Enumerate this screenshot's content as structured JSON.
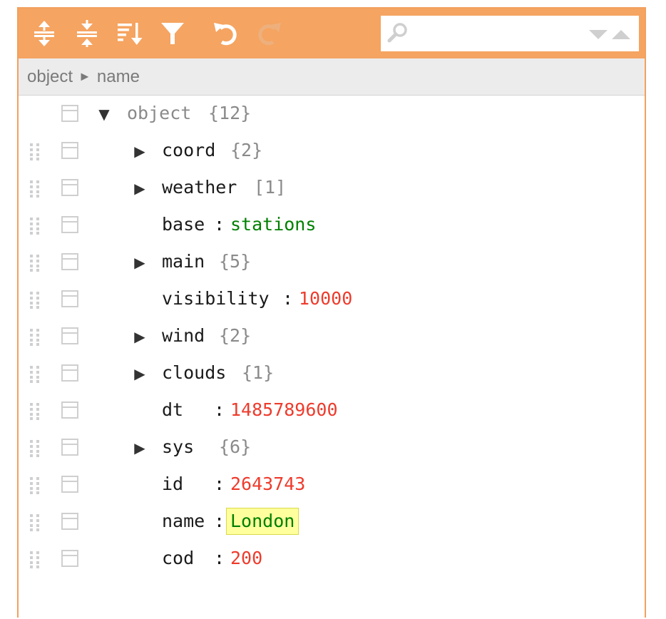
{
  "toolbar": {
    "buttons": [
      {
        "name": "expand-all-button",
        "icon": "expand-all-icon",
        "enabled": true
      },
      {
        "name": "collapse-all-button",
        "icon": "collapse-all-icon",
        "enabled": true
      },
      {
        "name": "sort-button",
        "icon": "sort-icon",
        "enabled": true
      },
      {
        "name": "filter-button",
        "icon": "filter-icon",
        "enabled": true
      },
      {
        "name": "undo-button",
        "icon": "undo-icon",
        "enabled": true
      },
      {
        "name": "redo-button",
        "icon": "redo-icon",
        "enabled": false
      }
    ],
    "search": {
      "value": "",
      "placeholder": ""
    }
  },
  "breadcrumb": {
    "items": [
      "object",
      "name"
    ],
    "separator": "►"
  },
  "tree": {
    "root": {
      "field": "object",
      "count": "{12}",
      "expanded": true
    },
    "nodes": [
      {
        "field": "coord",
        "type": "object",
        "count": "{2}"
      },
      {
        "field": "weather",
        "type": "array",
        "count": "[1]"
      },
      {
        "field": "base",
        "type": "string",
        "value": "stations"
      },
      {
        "field": "main",
        "type": "object",
        "count": "{5}"
      },
      {
        "field": "visibility",
        "type": "number",
        "value": "10000"
      },
      {
        "field": "wind",
        "type": "object",
        "count": "{2}"
      },
      {
        "field": "clouds",
        "type": "object",
        "count": "{1}"
      },
      {
        "field": "dt",
        "type": "number",
        "value": "1485789600"
      },
      {
        "field": "sys",
        "type": "object",
        "count": "{6}"
      },
      {
        "field": "id",
        "type": "number",
        "value": "2643743"
      },
      {
        "field": "name",
        "type": "string",
        "value": "London",
        "highlighted": true
      },
      {
        "field": "cod",
        "type": "number",
        "value": "200"
      }
    ],
    "separator": ":"
  },
  "colors": {
    "toolbar_bg": "#f5a461",
    "border": "#f3a05f",
    "string_value": "#008000",
    "number_value": "#ee3b2c",
    "highlight_bg": "#ffff9e"
  }
}
